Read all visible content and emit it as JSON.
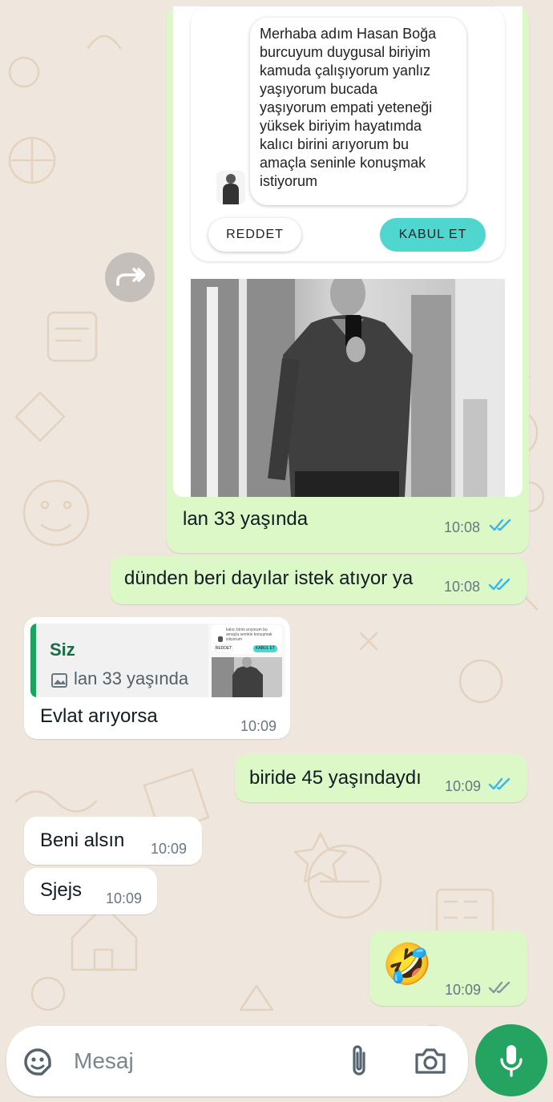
{
  "messages": {
    "forwarded_card": {
      "profile_text": "Merhaba adım Hasan Boğa burcuyum duygusal biriyim kamuda çalışıyorum yanlız yaşıyorum bucada yaşıyorum empati yeteneği yüksek biriyim hayatımda kalıcı birini arıyorum bu amaçla seninle konuşmak istiyorum",
      "profile_lines": [
        "Merhaba adım Hasan Boğa",
        "burcuyum duygusal biriyim",
        "kamuda çalışıyorum yanlız",
        "yaşıyorum bucada",
        "yaşıyorum empati yeteneği",
        "yüksek biriyim hayatımda",
        "kalıcı birini arıyorum bu",
        "amaçla seninle konuşmak",
        "istiyorum"
      ],
      "reject_label": "REDDET",
      "accept_label": "KABUL ET",
      "caption": "lan 33 yaşında",
      "time": "10:08",
      "status": "read"
    },
    "msg2": {
      "text": "dünden beri dayılar istek atıyor ya",
      "time": "10:08",
      "status": "read"
    },
    "reply1": {
      "quoted_author": "Siz",
      "quoted_text": "lan 33 yaşında",
      "thumb_lines": [
        "kalıcı birini arıyorum bu",
        "amaçla seninle konuşmak",
        "istiyorum"
      ],
      "thumb_reject": "REDDET",
      "thumb_accept": "KABUL ET",
      "text": "Evlat arıyorsa",
      "time": "10:09"
    },
    "msg4": {
      "text": "biride 45 yaşındaydı",
      "time": "10:09",
      "status": "read"
    },
    "msg5": {
      "text": "Beni alsın",
      "time": "10:09"
    },
    "msg6": {
      "text": "Sjejs",
      "time": "10:09"
    },
    "msg7": {
      "emoji": "🤣",
      "time": "10:09",
      "status": "delivered"
    }
  },
  "input": {
    "placeholder": "Mesaj"
  },
  "icons": [
    "forward-icon",
    "sticker-icon",
    "attach-icon",
    "camera-icon",
    "mic-icon",
    "image-icon",
    "double-check-icon"
  ],
  "colors": {
    "background": "#efe7dd",
    "outgoing_bubble": "#dcf8c6",
    "incoming_bubble": "#ffffff",
    "read_ticks": "#34b7f1",
    "accent_green": "#25a461",
    "quote_bar": "#1da35f",
    "accept_button": "#4fd6cf"
  }
}
